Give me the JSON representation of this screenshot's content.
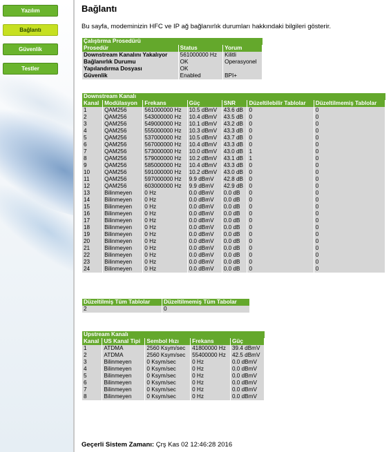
{
  "nav": {
    "items": [
      {
        "label": "Yazılım",
        "active": false
      },
      {
        "label": "Bağlantı",
        "active": true
      },
      {
        "label": "Güvenlik",
        "active": false
      },
      {
        "label": "Testler",
        "active": false
      }
    ]
  },
  "page": {
    "title": "Bağlantı",
    "description": "Bu sayfa, modeminizin HFC ve IP ağ bağlanırlık durumları hakkındaki bilgileri gösterir."
  },
  "startup": {
    "caption": "Çalıştırma Prosedürü",
    "headers": [
      "Prosedür",
      "Status",
      "Yorum"
    ],
    "rows": [
      [
        "Downstream Kanalını Yakalıyor",
        "561000000 Hz",
        "Kilitli"
      ],
      [
        "Bağlanırlık Durumu",
        "OK",
        "Operasyonel"
      ],
      [
        "Yapılandırma Dosyası",
        "OK",
        ""
      ],
      [
        "Güvenlik",
        "Enabled",
        "BPI+"
      ]
    ]
  },
  "downstream": {
    "caption": "Downstream Kanalı",
    "headers": [
      "Kanal",
      "Modülasyon",
      "Frekans",
      "Güç",
      "SNR",
      "Düzeltilebilir Tablolar",
      "Düzeltilmemiş Tablolar"
    ],
    "rows": [
      [
        "1",
        "QAM256",
        "561000000 Hz",
        "10.5 dBmV",
        "43.6 dB",
        "0",
        "0"
      ],
      [
        "2",
        "QAM256",
        "543000000 Hz",
        "10.4 dBmV",
        "43.5 dB",
        "0",
        "0"
      ],
      [
        "3",
        "QAM256",
        "549000000 Hz",
        "10.1 dBmV",
        "43.2 dB",
        "0",
        "0"
      ],
      [
        "4",
        "QAM256",
        "555000000 Hz",
        "10.3 dBmV",
        "43.3 dB",
        "0",
        "0"
      ],
      [
        "5",
        "QAM256",
        "537000000 Hz",
        "10.5 dBmV",
        "43.7 dB",
        "0",
        "0"
      ],
      [
        "6",
        "QAM256",
        "567000000 Hz",
        "10.4 dBmV",
        "43.3 dB",
        "0",
        "0"
      ],
      [
        "7",
        "QAM256",
        "573000000 Hz",
        "10.0 dBmV",
        "43.0 dB",
        "1",
        "0"
      ],
      [
        "8",
        "QAM256",
        "579000000 Hz",
        "10.2 dBmV",
        "43.1 dB",
        "1",
        "0"
      ],
      [
        "9",
        "QAM256",
        "585000000 Hz",
        "10.4 dBmV",
        "43.3 dB",
        "0",
        "0"
      ],
      [
        "10",
        "QAM256",
        "591000000 Hz",
        "10.2 dBmV",
        "43.0 dB",
        "0",
        "0"
      ],
      [
        "11",
        "QAM256",
        "597000000 Hz",
        "9.9 dBmV",
        "42.8 dB",
        "0",
        "0"
      ],
      [
        "12",
        "QAM256",
        "603000000 Hz",
        "9.9 dBmV",
        "42.9 dB",
        "0",
        "0"
      ],
      [
        "13",
        "Bilinmeyen",
        "0 Hz",
        "0.0 dBmV",
        "0.0 dB",
        "0",
        "0"
      ],
      [
        "14",
        "Bilinmeyen",
        "0 Hz",
        "0.0 dBmV",
        "0.0 dB",
        "0",
        "0"
      ],
      [
        "15",
        "Bilinmeyen",
        "0 Hz",
        "0.0 dBmV",
        "0.0 dB",
        "0",
        "0"
      ],
      [
        "16",
        "Bilinmeyen",
        "0 Hz",
        "0.0 dBmV",
        "0.0 dB",
        "0",
        "0"
      ],
      [
        "17",
        "Bilinmeyen",
        "0 Hz",
        "0.0 dBmV",
        "0.0 dB",
        "0",
        "0"
      ],
      [
        "18",
        "Bilinmeyen",
        "0 Hz",
        "0.0 dBmV",
        "0.0 dB",
        "0",
        "0"
      ],
      [
        "19",
        "Bilinmeyen",
        "0 Hz",
        "0.0 dBmV",
        "0.0 dB",
        "0",
        "0"
      ],
      [
        "20",
        "Bilinmeyen",
        "0 Hz",
        "0.0 dBmV",
        "0.0 dB",
        "0",
        "0"
      ],
      [
        "21",
        "Bilinmeyen",
        "0 Hz",
        "0.0 dBmV",
        "0.0 dB",
        "0",
        "0"
      ],
      [
        "22",
        "Bilinmeyen",
        "0 Hz",
        "0.0 dBmV",
        "0.0 dB",
        "0",
        "0"
      ],
      [
        "23",
        "Bilinmeyen",
        "0 Hz",
        "0.0 dBmV",
        "0.0 dB",
        "0",
        "0"
      ],
      [
        "24",
        "Bilinmeyen",
        "0 Hz",
        "0.0 dBmV",
        "0.0 dB",
        "0",
        "0"
      ]
    ]
  },
  "totals": {
    "headers": [
      "Düzeltilmiş Tüm Tablolar",
      "Düzeltilmemiş Tüm Tabolar"
    ],
    "rows": [
      [
        "2",
        "0"
      ]
    ]
  },
  "upstream": {
    "caption": "Upstream Kanalı",
    "headers": [
      "Kanal",
      "US Kanal Tipi",
      "Sembol Hızı",
      "Frekans",
      "Güç"
    ],
    "rows": [
      [
        "1",
        "ATDMA",
        "2560 Ksym/sec",
        "41800000 Hz",
        "39.4 dBmV"
      ],
      [
        "2",
        "ATDMA",
        "2560 Ksym/sec",
        "55400000 Hz",
        "42.5 dBmV"
      ],
      [
        "3",
        "Bilinmeyen",
        "0 Ksym/sec",
        "0 Hz",
        "0.0 dBmV"
      ],
      [
        "4",
        "Bilinmeyen",
        "0 Ksym/sec",
        "0 Hz",
        "0.0 dBmV"
      ],
      [
        "5",
        "Bilinmeyen",
        "0 Ksym/sec",
        "0 Hz",
        "0.0 dBmV"
      ],
      [
        "6",
        "Bilinmeyen",
        "0 Ksym/sec",
        "0 Hz",
        "0.0 dBmV"
      ],
      [
        "7",
        "Bilinmeyen",
        "0 Ksym/sec",
        "0 Hz",
        "0.0 dBmV"
      ],
      [
        "8",
        "Bilinmeyen",
        "0 Ksym/sec",
        "0 Hz",
        "0.0 dBmV"
      ]
    ]
  },
  "system_time": {
    "label": "Geçerli Sistem Zamanı:",
    "value": "Çrş Kas 02 12:46:28 2016"
  },
  "colors": {
    "header_green": "#64a82c",
    "nav_green": "#6ab42d",
    "nav_active": "#c6e021",
    "row_gray": "#d6d6d6"
  }
}
